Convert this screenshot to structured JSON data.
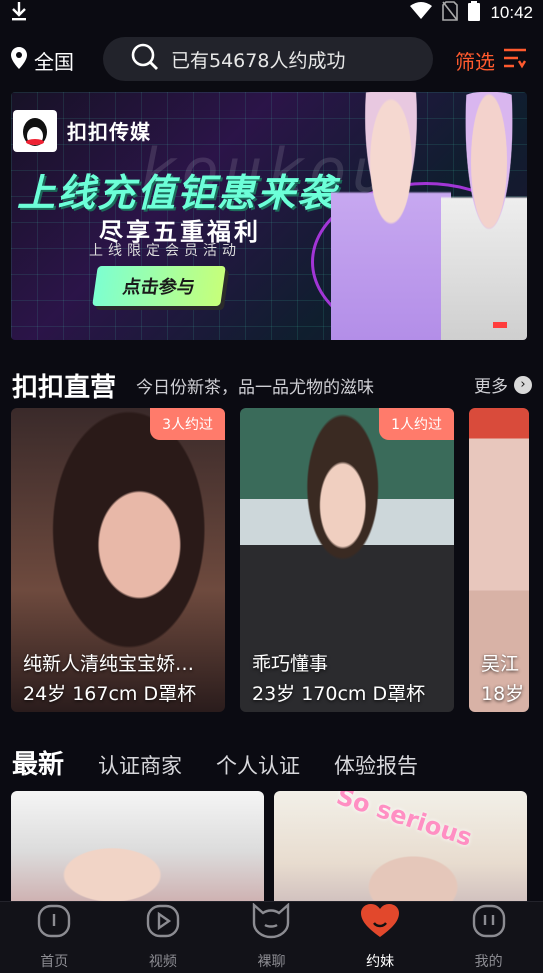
{
  "status_bar": {
    "time": "10:42",
    "icons": [
      "download-icon",
      "wifi-icon",
      "no-sim-icon",
      "battery-icon"
    ]
  },
  "header": {
    "location_label": "全国",
    "search_text": "已有54678人约成功",
    "filter_label": "筛选"
  },
  "banner": {
    "brand_name": "扣扣传媒",
    "watermark": "koukou",
    "headline": "上线充值钜惠来袭",
    "subtitle": "尽享五重福利",
    "tagline": "上线限定会员活动",
    "cta_label": "点击参与"
  },
  "featured": {
    "title": "扣扣直营",
    "subtitle": "今日份新茶，品一品尤物的滋味",
    "more_label": "更多",
    "cards": [
      {
        "badge": "3人约过",
        "name": "纯新人清纯宝宝娇…",
        "meta": "24岁 167cm D罩杯"
      },
      {
        "badge": "1人约过",
        "name": "乖巧懂事",
        "meta": "23岁 170cm D罩杯"
      },
      {
        "badge": "",
        "name": "吴江",
        "meta": "18岁"
      }
    ]
  },
  "latest_tabs": {
    "main": "最新",
    "items": [
      "认证商家",
      "个人认证",
      "体验报告"
    ]
  },
  "bottom_nav": {
    "items": [
      {
        "label": "首页",
        "icon": "home-icon",
        "active": false
      },
      {
        "label": "视频",
        "icon": "video-icon",
        "active": false
      },
      {
        "label": "裸聊",
        "icon": "cat-face-icon",
        "active": false
      },
      {
        "label": "约妹",
        "icon": "heart-icon",
        "active": true
      },
      {
        "label": "我的",
        "icon": "profile-icon",
        "active": false
      }
    ]
  },
  "colors": {
    "accent": "#ff5a2e",
    "badge": "#ff7b6b",
    "background": "#0b0b12"
  }
}
